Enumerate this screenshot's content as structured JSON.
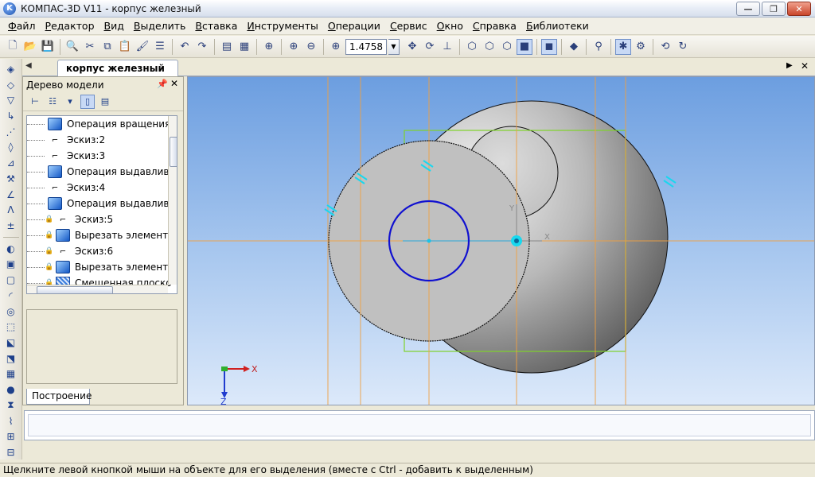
{
  "window": {
    "title": "КОМПАС-3D V11 - корпус железный",
    "app_icon": "kompas-logo-icon"
  },
  "menu": [
    "Файл",
    "Редактор",
    "Вид",
    "Выделить",
    "Вставка",
    "Инструменты",
    "Операции",
    "Сервис",
    "Окно",
    "Справка",
    "Библиотеки"
  ],
  "toolbar": {
    "zoom_value": "1.4758"
  },
  "document_tab": "корпус железный",
  "tree": {
    "title": "Дерево модели",
    "items": [
      {
        "label": "Операция вращения:",
        "icon": "rotation-operation-icon",
        "locked": false
      },
      {
        "label": "Эскиз:2",
        "icon": "sketch-icon",
        "locked": false
      },
      {
        "label": "Эскиз:3",
        "icon": "sketch-icon",
        "locked": false
      },
      {
        "label": "Операция выдавлива",
        "icon": "extrusion-operation-icon",
        "locked": false
      },
      {
        "label": "Эскиз:4",
        "icon": "sketch-icon",
        "locked": false
      },
      {
        "label": "Операция выдавлива",
        "icon": "extrusion-operation-icon",
        "locked": false
      },
      {
        "label": "Эскиз:5",
        "icon": "sketch-icon",
        "locked": true
      },
      {
        "label": "Вырезать элемент в",
        "icon": "cut-element-icon",
        "locked": true
      },
      {
        "label": "Эскиз:6",
        "icon": "sketch-icon",
        "locked": true
      },
      {
        "label": "Вырезать элемент в",
        "icon": "cut-element-icon",
        "locked": true
      },
      {
        "label": "Смещенная плоско",
        "icon": "offset-plane-icon",
        "locked": true
      }
    ],
    "bottom_tab": "Построение"
  },
  "viewport": {
    "axis_x_label": "X",
    "axis_z_label": "Z",
    "origin_x_label": "X",
    "origin_y_label": "Y"
  },
  "status": {
    "text": "Щелкните левой кнопкой мыши на объекте для его выделения (вместе с Ctrl - добавить к выделенным)"
  }
}
